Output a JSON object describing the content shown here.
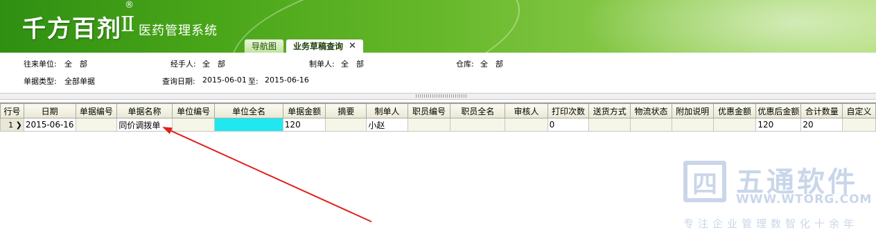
{
  "header": {
    "brand": "千方百剂",
    "brand_roman": "Ⅱ",
    "registered": "®",
    "system_name": "医药管理系统",
    "tabs": [
      {
        "label": "导航图"
      },
      {
        "label": "业务草稿查询",
        "close": "✕"
      }
    ]
  },
  "filters": {
    "counterparty_label": "往来单位:",
    "counterparty_value": "全　部",
    "handler_label": "经手人:",
    "handler_value": "全　部",
    "creator_label": "制单人:",
    "creator_value": "全　部",
    "warehouse_label": "仓库:",
    "warehouse_value": "全　部",
    "doctype_label": "单据类型:",
    "doctype_value": "全部单据",
    "date_label": "查询日期:",
    "date_from": "2015-06-01",
    "date_sep": "至:",
    "date_to": "2015-06-16"
  },
  "table": {
    "columns": [
      "行号",
      "日期",
      "单据编号",
      "单据名称",
      "单位编号",
      "单位全名",
      "单据金额",
      "摘要",
      "制单人",
      "职员编号",
      "职员全名",
      "审核人",
      "打印次数",
      "送货方式",
      "物流状态",
      "附加说明",
      "优惠金额",
      "优惠后金额",
      "合计数量",
      "自定义"
    ],
    "rows": [
      {
        "cells": [
          "1",
          "2015-06-16",
          "",
          "同价调拨单",
          "",
          "",
          "120",
          "",
          "小赵",
          "",
          "",
          "",
          "0",
          "",
          "",
          "",
          "",
          "120",
          "20",
          ""
        ]
      }
    ]
  },
  "watermark": {
    "logo": "四",
    "name": "五通软件",
    "url": "WWW.WTORG.COM",
    "slogan": "专注企业管理数智化十余年"
  },
  "colors": {
    "header_green": "#4aa619",
    "highlight_cyan": "#20e8f0",
    "arrow_red": "#e0201a"
  }
}
